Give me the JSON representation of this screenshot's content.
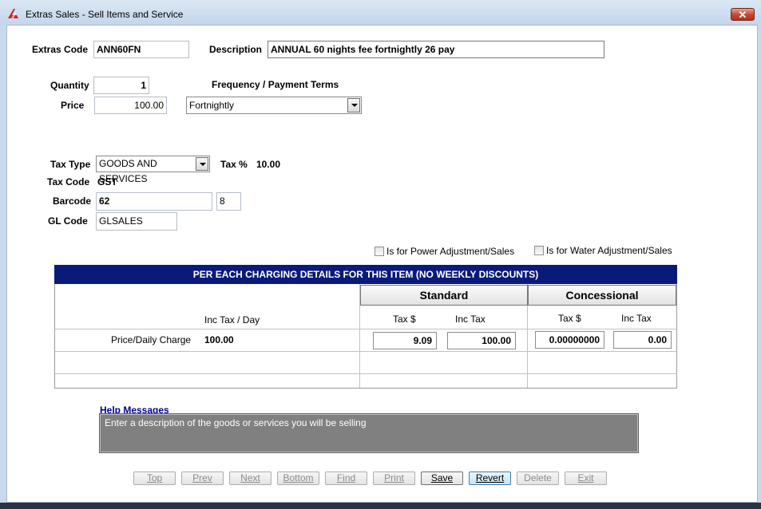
{
  "window": {
    "title": "Extras Sales - Sell Items and Service",
    "close_label": "✕"
  },
  "form": {
    "extras_code_label": "Extras Code",
    "extras_code": "ANN60FN",
    "description_label": "Description",
    "description": "ANNUAL 60 nights fee fortnightly 26 pay",
    "quantity_label": "Quantity",
    "quantity": "1",
    "frequency_label": "Frequency / Payment Terms",
    "price_label": "Price",
    "price": "100.00",
    "frequency": "Fortnightly",
    "tax_type_label": "Tax Type",
    "tax_type": "GOODS AND SERVICES",
    "tax_pct_label": "Tax %",
    "tax_pct": "10.00",
    "tax_code_label": "Tax Code",
    "tax_code": "GST",
    "barcode_label": "Barcode",
    "barcode": "62",
    "barcode_check": "8",
    "gl_code_label": "GL Code",
    "gl_code": "GLSALES",
    "power_label": "Is for Power  Adjustment/Sales",
    "water_label": "Is for Water  Adjustment/Sales"
  },
  "grid": {
    "header": "PER EACH CHARGING DETAILS FOR THIS ITEM (NO WEEKLY DISCOUNTS)",
    "standard_label": "Standard",
    "concessional_label": "Concessional",
    "inc_tax_day": "Inc Tax / Day",
    "std_tax_col": "Tax $",
    "std_inc_col": "Inc Tax",
    "con_tax_col": "Tax $",
    "con_inc_col": "Inc Tax",
    "row": {
      "label": "Price/Daily Charge",
      "inc_tax_day": "100.00",
      "std_tax": "9.09",
      "std_inc": "100.00",
      "con_tax": "0.00000000",
      "con_inc": "0.00"
    }
  },
  "help": {
    "title": "Help Messages",
    "message": "Enter a description of the goods or services you will be selling"
  },
  "buttons": {
    "top": "Top",
    "prev": "Prev",
    "next": "Next",
    "bottom": "Bottom",
    "find": "Find",
    "print": "Print",
    "save": "Save",
    "revert": "Revert",
    "delete": "Delete",
    "exit": "Exit"
  },
  "colors": {
    "grid_header": "#0a1a7a",
    "help_box": "#808080",
    "help_title": "#00008b"
  }
}
